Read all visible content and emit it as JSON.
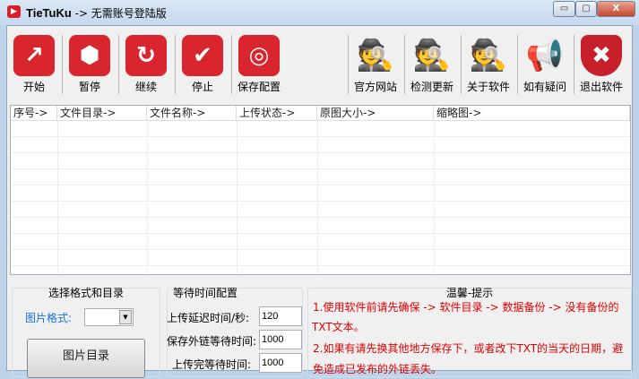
{
  "window": {
    "app_name": "TieTuKu",
    "title_suffix": " -> 无需账号登陆版",
    "minimize": "▭",
    "maximize": "▢",
    "close": "X"
  },
  "toolbar": {
    "left": [
      {
        "label": "开始",
        "icon": "chart-up-icon",
        "glyph": "↗"
      },
      {
        "label": "暂停",
        "icon": "pause-icon",
        "glyph": "⬢"
      },
      {
        "label": "继续",
        "icon": "resume-icon",
        "glyph": "↻"
      },
      {
        "label": "停止",
        "icon": "check-icon",
        "glyph": "✔"
      },
      {
        "label": "保存配置",
        "icon": "chrome-icon",
        "glyph": "◎"
      }
    ],
    "right": [
      {
        "label": "官方网站",
        "icon": "spy-icon",
        "glyph": "🕵"
      },
      {
        "label": "检测更新",
        "icon": "spy-update-icon",
        "glyph": "🕵"
      },
      {
        "label": "关于软件",
        "icon": "spy-info-icon",
        "glyph": "🕵"
      },
      {
        "label": "如有疑问",
        "icon": "spy-megaphone-icon",
        "glyph": "📢"
      },
      {
        "label": "退出软件",
        "icon": "shield-exit-icon",
        "glyph": "✖"
      }
    ]
  },
  "list": {
    "columns": [
      "序号->",
      "文件目录->",
      "文件名称->",
      "上传状态->",
      "原图大小->",
      "缩略图->"
    ]
  },
  "format_group": {
    "title": "选择格式和目录",
    "format_label": "图片格式:",
    "format_value": "",
    "dir_button": "图片目录"
  },
  "wait_group": {
    "title": "等待时间配置",
    "upload_delay_label": "上传延迟时间/秒:",
    "upload_delay": "120",
    "save_wait_label": "保存外链等待时间:",
    "save_wait": "1000",
    "upload_done_label": "上传完等待时间:",
    "upload_done": "1000"
  },
  "tips": {
    "title": "温馨-提示",
    "line1": "1.使用软件前请先确保 -> 软件目录 -> 数据备份 -> 没有备份的",
    "line2": "TXT文本。",
    "line3": "2.如果有请先换其他地方保存下，或者改下TXT的当天的日期，避",
    "line4": "免造成已发布的外链丢失。"
  }
}
